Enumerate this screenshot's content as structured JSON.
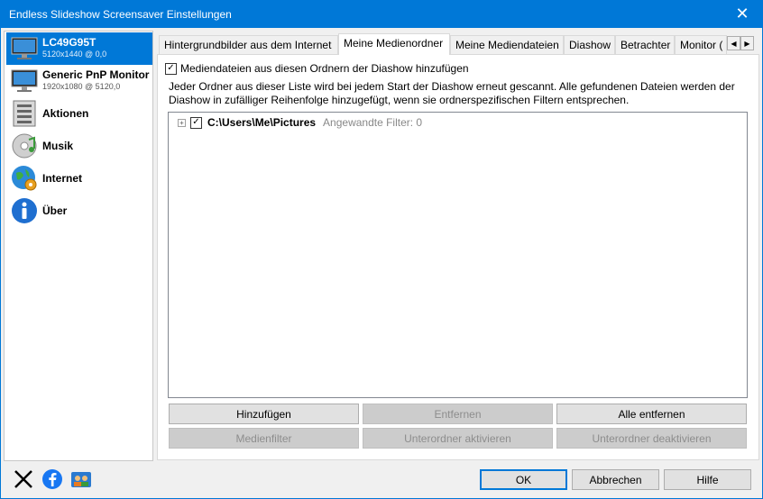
{
  "window": {
    "title": "Endless Slideshow Screensaver Einstellungen",
    "close_glyph": "✕"
  },
  "sidebar": {
    "items": [
      {
        "name": "LC49G95T",
        "sub": "5120x1440 @ 0,0"
      },
      {
        "name": "Generic PnP Monitor",
        "sub": "1920x1080 @ 5120,0"
      },
      {
        "name": "Aktionen"
      },
      {
        "name": "Musik"
      },
      {
        "name": "Internet"
      },
      {
        "name": "Über"
      }
    ]
  },
  "tabs": [
    "Hintergrundbilder aus dem Internet",
    "Meine Medienordner",
    "Meine Mediendateien",
    "Diashow",
    "Betrachter",
    "Monitor ("
  ],
  "tab_nav": {
    "left": "◀",
    "right": "▶"
  },
  "panel": {
    "add_checkbox_label": "Mediendateien aus diesen Ordnern der Diashow hinzufügen",
    "description": "Jeder Ordner aus dieser Liste wird bei jedem Start der Diashow erneut gescannt. Alle gefundenen Dateien werden der Diashow in zufälliger Reihenfolge hinzugefügt, wenn sie ordnerspezifischen Filtern entsprechen.",
    "folders": [
      {
        "expander": "+",
        "path": "C:\\Users\\Me\\Pictures",
        "filter": "Angewandte Filter: 0"
      }
    ],
    "buttons": {
      "add": "Hinzufügen",
      "remove": "Entfernen",
      "remove_all": "Alle entfernen",
      "media_filter": "Medienfilter",
      "enable_subfolders": "Unterordner aktivieren",
      "disable_subfolders": "Unterordner deaktivieren"
    }
  },
  "footer": {
    "ok": "OK",
    "cancel": "Abbrechen",
    "help": "Hilfe"
  },
  "checkmark": "✓",
  "colors": {
    "accent": "#0078d7",
    "selected_bg": "#0078d7"
  }
}
